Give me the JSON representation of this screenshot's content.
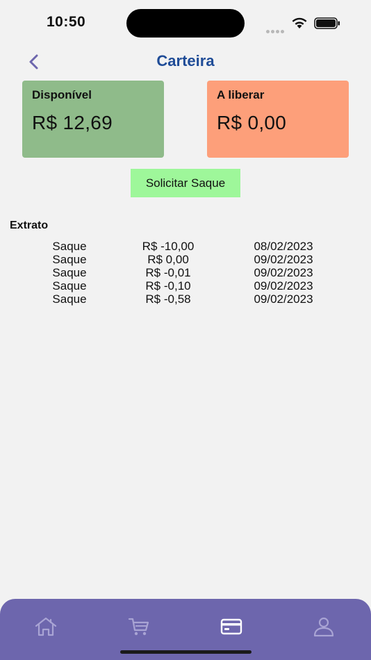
{
  "status_bar": {
    "time": "10:50"
  },
  "header": {
    "title": "Carteira",
    "back_icon": "chevron-left-icon",
    "accent_color": "#1f4c97"
  },
  "balances": {
    "available": {
      "label": "Disponível",
      "value": "R$ 12,69",
      "color": "#8fbb8a"
    },
    "pending": {
      "label": "A liberar",
      "value": "R$ 0,00",
      "color": "#fd9f7a"
    }
  },
  "actions": {
    "withdraw_label": "Solicitar Saque"
  },
  "statement": {
    "title": "Extrato",
    "rows": [
      {
        "type": "Saque",
        "amount": "R$ -10,00",
        "date": "08/02/2023"
      },
      {
        "type": "Saque",
        "amount": "R$ 0,00",
        "date": "09/02/2023"
      },
      {
        "type": "Saque",
        "amount": "R$ -0,01",
        "date": "09/02/2023"
      },
      {
        "type": "Saque",
        "amount": "R$ -0,10",
        "date": "09/02/2023"
      },
      {
        "type": "Saque",
        "amount": "R$ -0,58",
        "date": "09/02/2023"
      }
    ]
  },
  "tab_bar": {
    "color": "#6d66ad",
    "items": [
      {
        "icon": "home-icon",
        "active": false
      },
      {
        "icon": "cart-icon",
        "active": false
      },
      {
        "icon": "wallet-card-icon",
        "active": true
      },
      {
        "icon": "profile-icon",
        "active": false
      }
    ]
  }
}
